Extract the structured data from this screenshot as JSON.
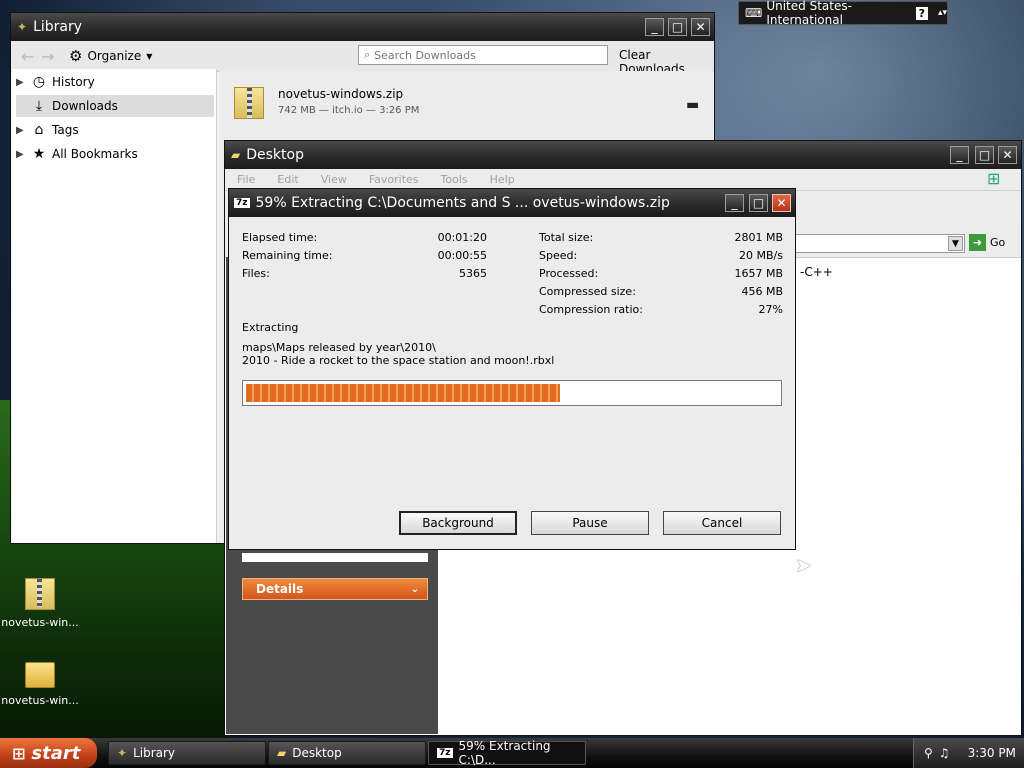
{
  "language_bar": {
    "label": "United States-International",
    "help": "?"
  },
  "library": {
    "title": "Library",
    "organize": "Organize",
    "search_placeholder": "Search Downloads",
    "clear_downloads": "Clear Downloads",
    "sidebar": [
      {
        "label": "History",
        "icon": "clock-icon"
      },
      {
        "label": "Downloads",
        "icon": "download-icon"
      },
      {
        "label": "Tags",
        "icon": "tag-icon"
      },
      {
        "label": "All Bookmarks",
        "icon": "star-icon"
      }
    ],
    "download": {
      "name": "novetus-windows.zip",
      "meta": "742 MB — itch.io — 3:26 PM"
    }
  },
  "desktop_window": {
    "title": "Desktop",
    "menu": [
      "File",
      "Edit",
      "View",
      "Favorites",
      "Tools",
      "Help"
    ],
    "go": "Go",
    "details": "Details",
    "partial_text": "-C++"
  },
  "sevenzip": {
    "title": "59% Extracting C:\\Documents and S ... ovetus-windows.zip",
    "progress": 0.59,
    "left_stats": [
      {
        "label": "Elapsed time:",
        "value": "00:01:20"
      },
      {
        "label": "Remaining time:",
        "value": "00:00:55"
      },
      {
        "label": "Files:",
        "value": "5365"
      }
    ],
    "right_stats": [
      {
        "label": "Total size:",
        "value": "2801 MB"
      },
      {
        "label": "Speed:",
        "value": "20 MB/s"
      },
      {
        "label": "Processed:",
        "value": "1657 MB"
      },
      {
        "label": "Compressed size:",
        "value": "456 MB"
      },
      {
        "label": "Compression ratio:",
        "value": "27%"
      }
    ],
    "status": "Extracting",
    "path_line1": "maps\\Maps released by year\\2010\\",
    "path_line2": "2010 - Ride a rocket to the space station and moon!.rbxl",
    "buttons": {
      "background": "Background",
      "pause": "Pause",
      "cancel": "Cancel"
    }
  },
  "desktop_icons": [
    {
      "label": "novetus-win..."
    },
    {
      "label": "novetus-win..."
    }
  ],
  "taskbar": {
    "start": "start",
    "items": [
      "Library",
      "Desktop",
      "59% Extracting C:\\D..."
    ],
    "clock": "3:30 PM"
  }
}
